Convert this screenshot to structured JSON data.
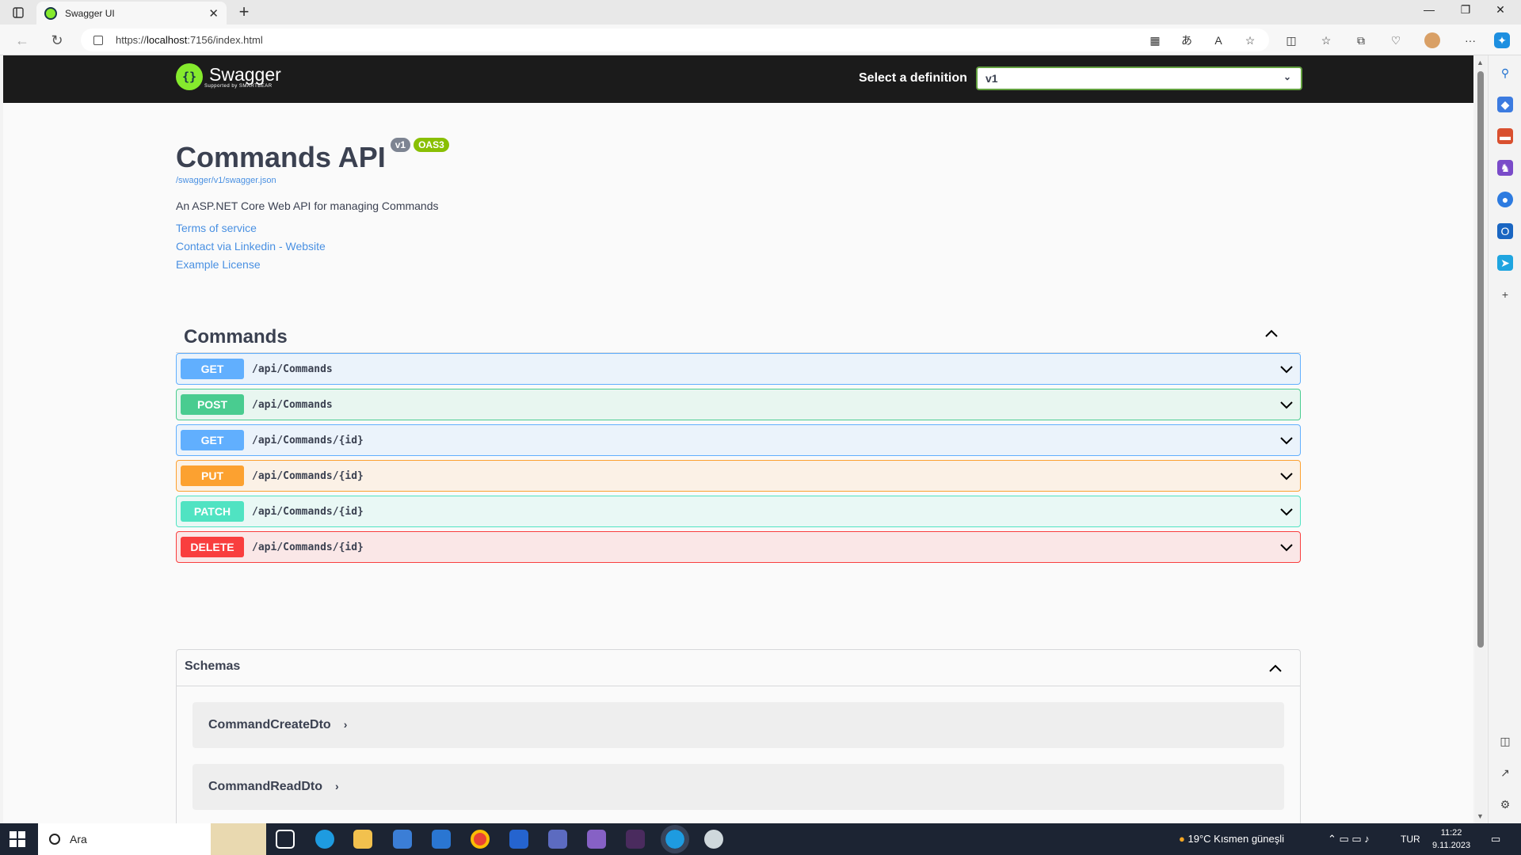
{
  "browser": {
    "tab_title": "Swagger UI",
    "url_prefix": "https://",
    "url_host": "localhost",
    "url_rest": ":7156/index.html"
  },
  "swagger": {
    "logo_text": "Swagger",
    "logo_sub": "Supported by SMARTBEAR",
    "definition_label": "Select a definition",
    "definition_value": "v1",
    "title": "Commands API",
    "version_badge": "v1",
    "oas_badge": "OAS3",
    "spec_link": "/swagger/v1/swagger.json",
    "description": "An ASP.NET Core Web API for managing Commands",
    "links": {
      "terms": "Terms of service",
      "contact": "Contact via Linkedin - Website",
      "license": "Example License"
    },
    "tag": "Commands",
    "operations": [
      {
        "method": "GET",
        "path": "/api/Commands",
        "color": "#61affe",
        "bg": "#ebf3fb",
        "border": "#61affe"
      },
      {
        "method": "POST",
        "path": "/api/Commands",
        "color": "#49cc90",
        "bg": "#e8f6f0",
        "border": "#49cc90"
      },
      {
        "method": "GET",
        "path": "/api/Commands/{id}",
        "color": "#61affe",
        "bg": "#ebf3fb",
        "border": "#61affe"
      },
      {
        "method": "PUT",
        "path": "/api/Commands/{id}",
        "color": "#fca130",
        "bg": "#fbf1e6",
        "border": "#fca130"
      },
      {
        "method": "PATCH",
        "path": "/api/Commands/{id}",
        "color": "#50e3c2",
        "bg": "#e9f8f5",
        "border": "#50e3c2"
      },
      {
        "method": "DELETE",
        "path": "/api/Commands/{id}",
        "color": "#f93e3e",
        "bg": "#fae7e7",
        "border": "#f93e3e"
      }
    ],
    "schemas_title": "Schemas",
    "models": [
      "CommandCreateDto",
      "CommandReadDto"
    ]
  },
  "taskbar": {
    "search_placeholder": "Ara",
    "weather": "19°C  Kısmen güneşli",
    "lang": "TUR",
    "time": "11:22",
    "date": "9.11.2023"
  }
}
